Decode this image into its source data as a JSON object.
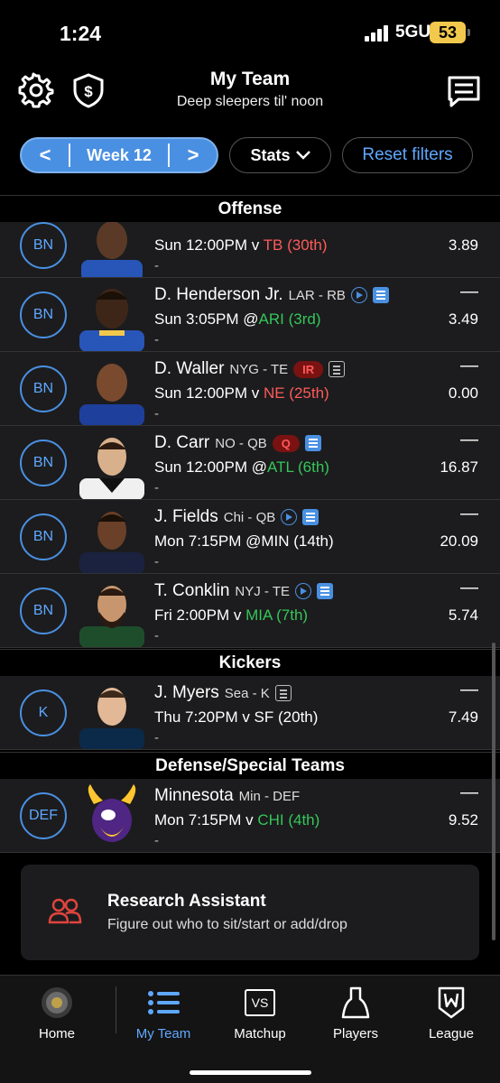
{
  "status": {
    "time": "1:24",
    "network": "5GUC",
    "battery": "53"
  },
  "header": {
    "title": "My Team",
    "subtitle": "Deep sleepers til' noon"
  },
  "filters": {
    "prev": "<",
    "week": "Week 12",
    "next": ">",
    "stats": "Stats",
    "reset": "Reset filters"
  },
  "sections": {
    "offense": "Offense",
    "kickers": "Kickers",
    "defense": "Defense/Special Teams"
  },
  "players": [
    {
      "slot": "BN",
      "name": "",
      "team": "",
      "game_pre": "Sun 12:00PM v ",
      "opp": "TB (30th)",
      "opp_color": "red",
      "dash": "-",
      "proj_dash": "",
      "proj": "3.89"
    },
    {
      "slot": "BN",
      "name": "D. Henderson Jr.",
      "team": "LAR - RB",
      "game_pre": "Sun 3:05PM @",
      "opp": "ARI (3rd)",
      "opp_color": "green",
      "dash": "-",
      "proj_dash": "—",
      "proj": "3.49"
    },
    {
      "slot": "BN",
      "name": "D. Waller",
      "team": "NYG - TE",
      "badge": "IR",
      "game_pre": "Sun 12:00PM v ",
      "opp": "NE (25th)",
      "opp_color": "red",
      "dash": "-",
      "proj_dash": "—",
      "proj": "0.00"
    },
    {
      "slot": "BN",
      "name": "D. Carr",
      "team": "NO - QB",
      "badge": "Q",
      "game_pre": "Sun 12:00PM @",
      "opp": "ATL (6th)",
      "opp_color": "green",
      "dash": "-",
      "proj_dash": "—",
      "proj": "16.87"
    },
    {
      "slot": "BN",
      "name": "J. Fields",
      "team": "Chi - QB",
      "game_pre": "Mon 7:15PM @MIN (14th)",
      "opp": "",
      "opp_color": "none",
      "dash": "-",
      "proj_dash": "—",
      "proj": "20.09"
    },
    {
      "slot": "BN",
      "name": "T. Conklin",
      "team": "NYJ - TE",
      "game_pre": "Fri 2:00PM v ",
      "opp": "MIA (7th)",
      "opp_color": "green",
      "dash": "-",
      "proj_dash": "—",
      "proj": "5.74"
    }
  ],
  "kicker": {
    "slot": "K",
    "name": "J. Myers",
    "team": "Sea - K",
    "game_pre": "Thu 7:20PM v SF (20th)",
    "dash": "-",
    "proj_dash": "—",
    "proj": "7.49"
  },
  "defense": {
    "slot": "DEF",
    "name": "Minnesota",
    "team": "Min - DEF",
    "game_pre": "Mon 7:15PM v ",
    "opp": "CHI (4th)",
    "dash": "-",
    "proj_dash": "—",
    "proj": "9.52"
  },
  "research": {
    "title": "Research Assistant",
    "subtitle": "Figure out who to sit/start or add/drop"
  },
  "tabs": [
    {
      "label": "Home"
    },
    {
      "label": "My Team"
    },
    {
      "label": "Matchup"
    },
    {
      "label": "Players"
    },
    {
      "label": "League"
    }
  ],
  "matchup_icon_text": "VS",
  "colors": {
    "accent": "#4a90e2",
    "red": "#ff5a5a",
    "green": "#34c759",
    "card": "#1c1c1e"
  }
}
